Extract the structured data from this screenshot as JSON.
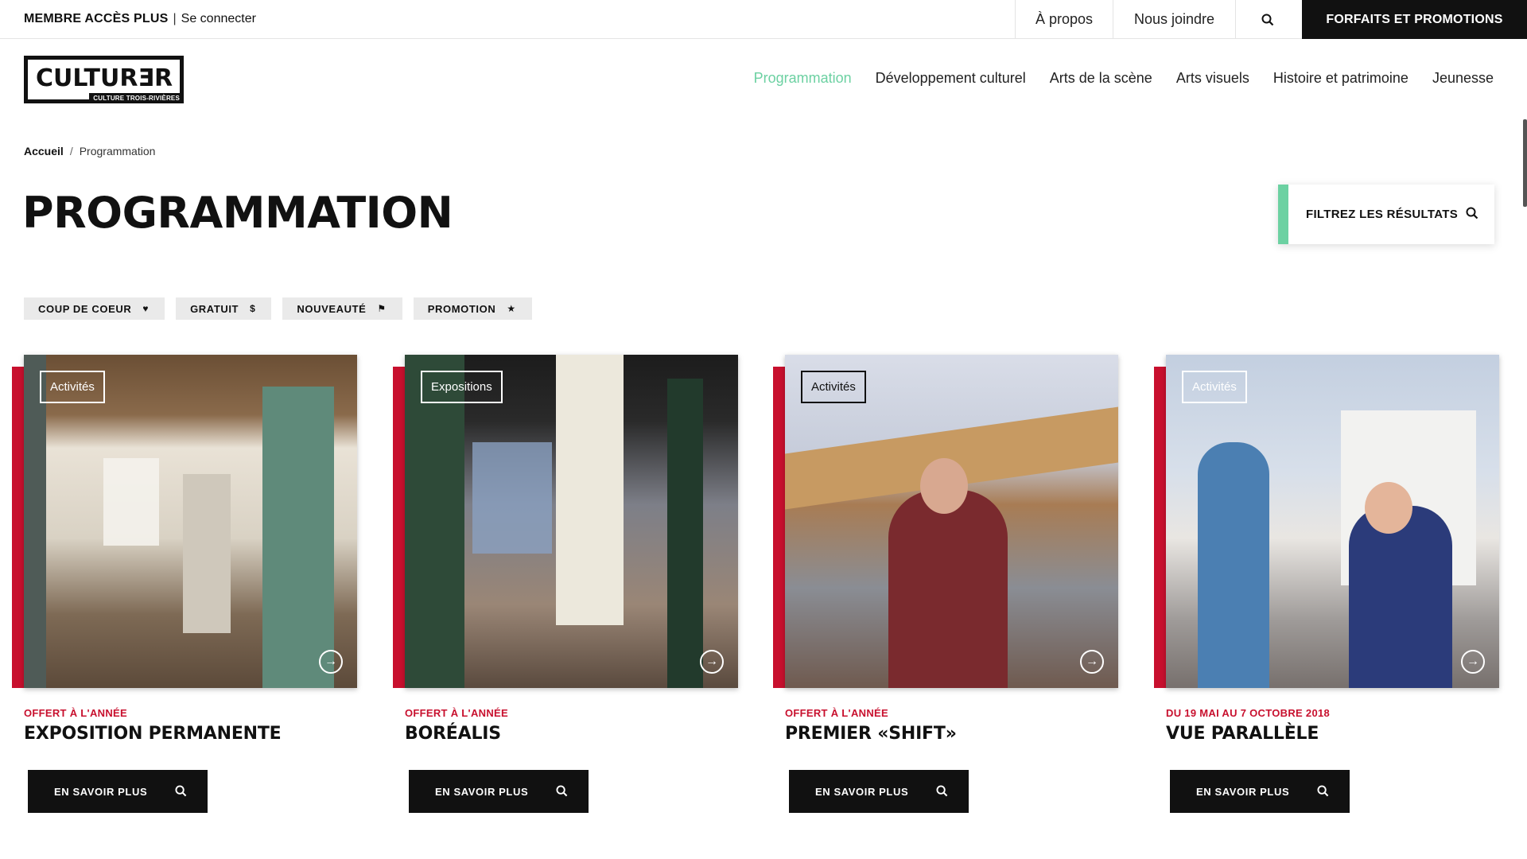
{
  "topbar": {
    "member": "MEMBRE ACCÈS PLUS",
    "separator": "|",
    "login": "Se connecter",
    "about": "À propos",
    "contact": "Nous joindre",
    "promo": "FORFAITS ET PROMOTIONS"
  },
  "logo": {
    "word": "CULTURƎR",
    "sub": "CULTURE TROIS-RIVIÈRES"
  },
  "nav": [
    "Programmation",
    "Développement culturel",
    "Arts de la scène",
    "Arts visuels",
    "Histoire et patrimoine",
    "Jeunesse"
  ],
  "breadcrumb": {
    "home": "Accueil",
    "separator": "/",
    "current": "Programmation"
  },
  "page_title": "PROGRAMMATION",
  "filter_label": "FILTREZ LES RÉSULTATS",
  "tags": [
    {
      "label": "COUP DE COEUR",
      "icon": "♥"
    },
    {
      "label": "GRATUIT",
      "icon": "$"
    },
    {
      "label": "NOUVEAUTÉ",
      "icon": "⚑"
    },
    {
      "label": "PROMOTION",
      "icon": "★"
    }
  ],
  "cards": [
    {
      "category": "Activités",
      "date": "OFFERT À L'ANNÉE",
      "title": "EXPOSITION PERMANENTE",
      "cta": "EN SAVOIR PLUS"
    },
    {
      "category": "Expositions",
      "date": "OFFERT À L'ANNÉE",
      "title": "BORÉALIS",
      "cta": "EN SAVOIR PLUS"
    },
    {
      "category": "Activités",
      "date": "OFFERT À L'ANNÉE",
      "title": "PREMIER «SHIFT»",
      "cta": "EN SAVOIR PLUS"
    },
    {
      "category": "Activités",
      "date": "DU 19 MAI AU 7 OCTOBRE 2018",
      "title": "VUE PARALLÈLE",
      "cta": "EN SAVOIR PLUS"
    }
  ],
  "colors": {
    "accent_green": "#6cd1a2",
    "brand_red": "#c8102e",
    "black": "#111111"
  }
}
